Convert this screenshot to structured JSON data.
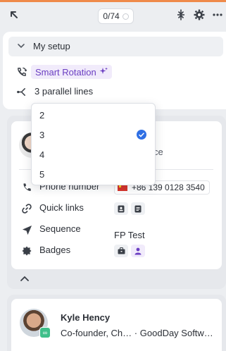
{
  "toolbar": {
    "counter": "0/74",
    "icons": [
      "collapse-arrow-icon",
      "expand-collapse-icon",
      "gear-icon",
      "more-icon"
    ]
  },
  "setup": {
    "title": "My setup",
    "mode_label": "Smart Rotation",
    "parallel_label": "3 parallel lines"
  },
  "dropdown": {
    "options": [
      "2",
      "3",
      "4",
      "5"
    ],
    "selected": "3"
  },
  "contact": {
    "partial_text": "ce",
    "phone_label": "Phone number",
    "phone_value": "+86 139 0128 3540",
    "quick_links_label": "Quick links",
    "sequence_label": "Sequence",
    "sequence_value": "FP Test",
    "badges_label": "Badges"
  },
  "contact2": {
    "name": "Kyle Hency",
    "role": "Co-founder, Ch…",
    "separator": "·",
    "company": "GoodDay Softw…"
  },
  "colors": {
    "accent_orange": "#ef8a4a",
    "smart_purple": "#6b3fc2",
    "check_blue": "#2f6fe4"
  }
}
